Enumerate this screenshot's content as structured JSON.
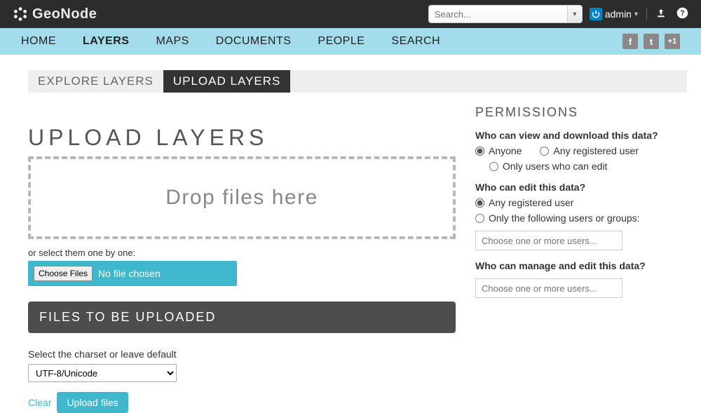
{
  "brand": "GeoNode",
  "search_placeholder": "Search...",
  "user": {
    "name": "admin"
  },
  "nav": {
    "items": [
      {
        "label": "HOME",
        "active": false
      },
      {
        "label": "LAYERS",
        "active": true
      },
      {
        "label": "MAPS",
        "active": false
      },
      {
        "label": "DOCUMENTS",
        "active": false
      },
      {
        "label": "PEOPLE",
        "active": false
      },
      {
        "label": "SEARCH",
        "active": false
      }
    ]
  },
  "tabs": {
    "items": [
      {
        "label": "EXPLORE LAYERS",
        "active": false
      },
      {
        "label": "UPLOAD LAYERS",
        "active": true
      }
    ]
  },
  "page_title": "UPLOAD LAYERS",
  "dropzone": "Drop files here",
  "or_select": "or select them one by one:",
  "choose": {
    "button": "Choose Files",
    "status": "No file chosen"
  },
  "files_header": "FILES TO BE UPLOADED",
  "charset": {
    "label": "Select the charset or leave default",
    "value": "UTF-8/Unicode"
  },
  "actions": {
    "clear": "Clear",
    "upload": "Upload files"
  },
  "permissions": {
    "title": "PERMISSIONS",
    "view": {
      "q": "Who can view and download this data?",
      "opts": [
        "Anyone",
        "Any registered user",
        "Only users who can edit"
      ]
    },
    "edit": {
      "q": "Who can edit this data?",
      "opts": [
        "Any registered user",
        "Only the following users or groups:"
      ],
      "placeholder": "Choose one or more users..."
    },
    "manage": {
      "q": "Who can manage and edit this data?",
      "placeholder": "Choose one or more users..."
    }
  }
}
